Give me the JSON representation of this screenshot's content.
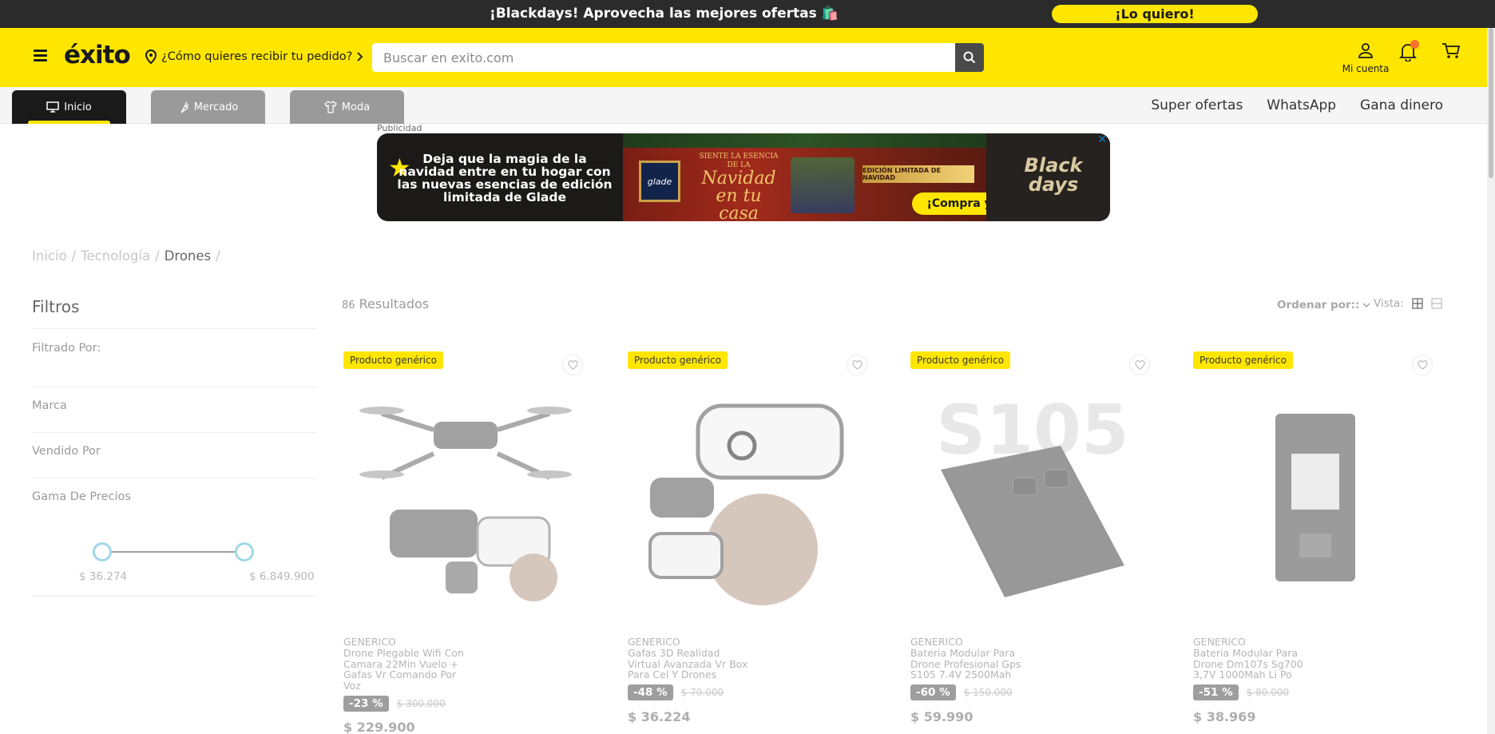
{
  "promo": {
    "text": "¡Blackdays! Aprovecha las mejores ofertas 🛍️",
    "cta": "¡Lo quiero!"
  },
  "header": {
    "logo": "éxito",
    "delivery_prompt": "¿Cómo quieres recibir tu pedido?",
    "search_placeholder": "Buscar en exito.com",
    "account_label": "Mi cuenta"
  },
  "nav": {
    "tabs": [
      {
        "label": "Inicio",
        "icon": "monitor-icon",
        "active": true
      },
      {
        "label": "Mercado",
        "icon": "carrot-icon",
        "active": false
      },
      {
        "label": "Moda",
        "icon": "shirt-icon",
        "active": false
      }
    ],
    "links": [
      "Super ofertas",
      "WhatsApp",
      "Gana dinero"
    ]
  },
  "ad": {
    "label": "Publicidad",
    "copy": "Deja que la magia de la navidad entre en tu hogar con las nuevas esencias de edición limitada de Glade",
    "glade": "glade",
    "navidad_small": "SIENTE LA ESENCIA DE LA",
    "navidad": "Navidad en tu casa",
    "edicion": "EDICIÓN LIMITADA DE NAVIDAD",
    "cta": "¡Compra ya!",
    "blackdays": "Black days"
  },
  "breadcrumb": {
    "items": [
      "Inicio",
      "Tecnología",
      "Drones"
    ],
    "separator": "/"
  },
  "filters": {
    "title": "Filtros",
    "filtered_by": "Filtrado Por:",
    "sections": [
      "Marca",
      "Vendido Por",
      "Gama De Precios"
    ],
    "price_min": "$ 36.274",
    "price_max": "$ 6.849.900"
  },
  "results": {
    "count": "86",
    "label": "Resultados",
    "sort_label": "Ordenar por::",
    "view_label": "Vista:"
  },
  "products": [
    {
      "badge": "Producto genérico",
      "brand": "GENERICO",
      "title": "Drone Plegable Wifi Con Camara 22Min Vuelo + Gafas Vr Comando Por Voz",
      "discount": "-23 %",
      "old_price": "$ 300.000",
      "price": "$ 229.900",
      "image": "drone-vr-image"
    },
    {
      "badge": "Producto genérico",
      "brand": "GENERICO",
      "title": "Gafas 3D Realidad Virtual Avanzada Vr Box Para Cel Y Drones",
      "discount": "-48 %",
      "old_price": "$ 70.000",
      "price": "$ 36.224",
      "image": "vr-box-image"
    },
    {
      "badge": "Producto genérico",
      "brand": "GENERICO",
      "title": "Bateria Modular Para Drone Profesional Gps S105 7.4V 2500Mah",
      "discount": "-60 %",
      "old_price": "$ 150.000",
      "price": "$ 59.990",
      "image": "battery-s105-image",
      "image_text": "S105"
    },
    {
      "badge": "Producto genérico",
      "brand": "GENERICO",
      "title": "Bateria Modular Para Drone Dm107s Sg700 3,7V 1000Mah Li Po",
      "discount": "-51 %",
      "old_price": "$ 80.000",
      "price": "$ 38.969",
      "image": "battery-dm107s-image"
    }
  ],
  "colors": {
    "brand_yellow": "#ffe600",
    "dark": "#2b2b2b",
    "notification": "#f5712c"
  }
}
